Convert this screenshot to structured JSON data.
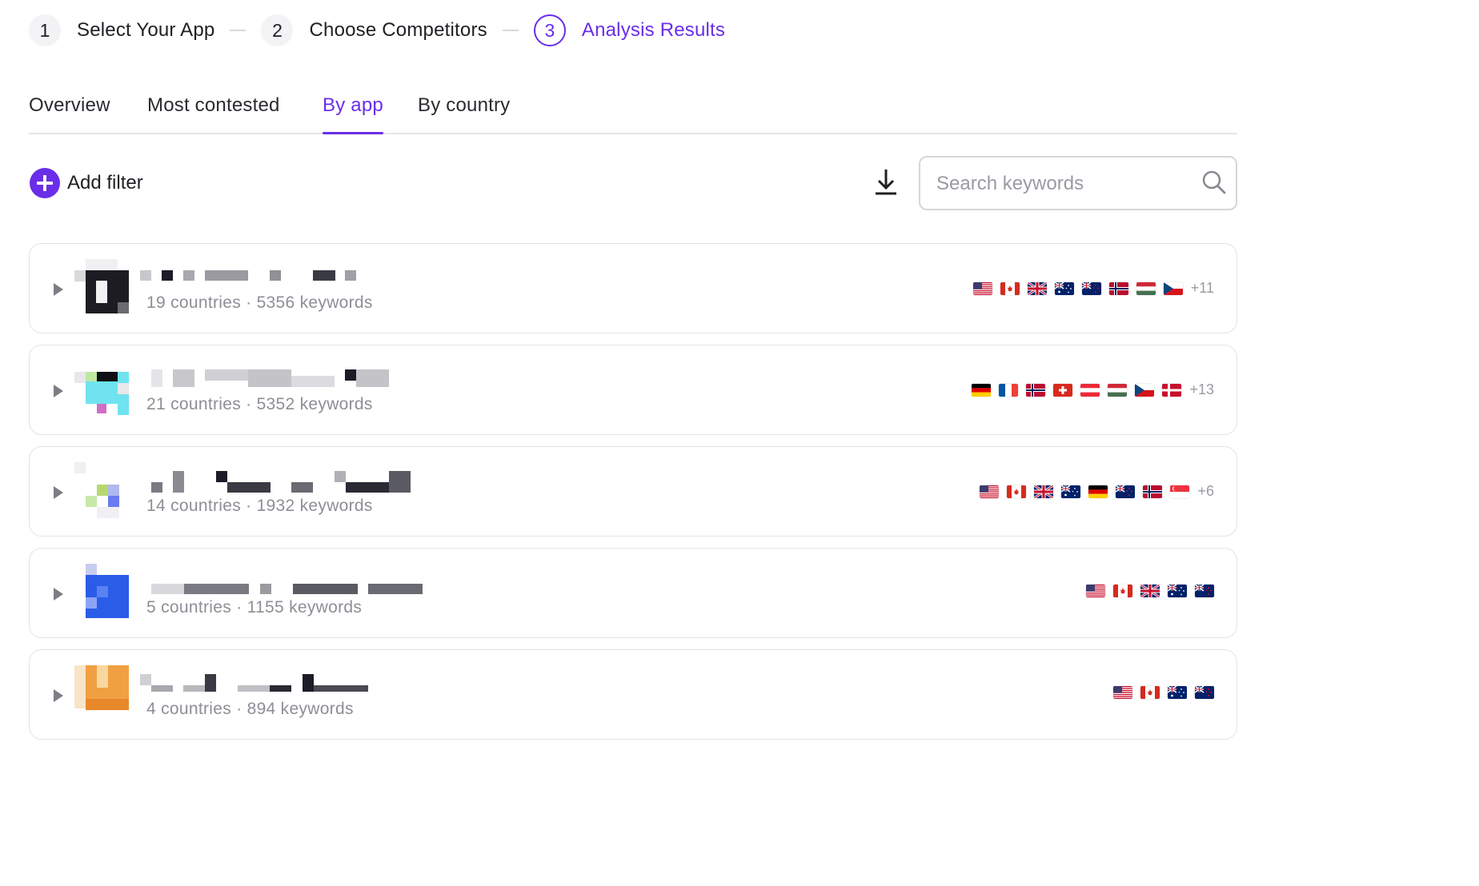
{
  "stepper": {
    "steps": [
      {
        "number": "1",
        "label": "Select Your App"
      },
      {
        "number": "2",
        "label": "Choose Competitors"
      },
      {
        "number": "3",
        "label": "Analysis Results"
      }
    ]
  },
  "tabs": [
    {
      "label": "Overview"
    },
    {
      "label": "Most contested"
    },
    {
      "label": "By app"
    },
    {
      "label": "By country"
    }
  ],
  "active_tab": "By app",
  "toolbar": {
    "add_filter_label": "Add filter",
    "download_icon": "download-icon",
    "search_placeholder": "Search keywords",
    "search_icon": "search-icon",
    "accent_color": "#6a2ee8"
  },
  "apps": [
    {
      "meta": "19 countries · 5356 keywords",
      "flags": [
        "us",
        "ca",
        "gb",
        "au",
        "nz",
        "no",
        "hu",
        "cz"
      ],
      "more": "+11"
    },
    {
      "meta": "21 countries · 5352 keywords",
      "flags": [
        "de",
        "fr",
        "no",
        "ch",
        "at",
        "hu",
        "cz",
        "dk"
      ],
      "more": "+13"
    },
    {
      "meta": "14 countries · 1932 keywords",
      "flags": [
        "us",
        "ca",
        "gb",
        "au",
        "de",
        "nz",
        "no",
        "sg"
      ],
      "more": "+6"
    },
    {
      "meta": "5 countries · 1155 keywords",
      "flags": [
        "us",
        "ca",
        "gb",
        "au",
        "nz"
      ],
      "more": ""
    },
    {
      "meta": "4 countries · 894 keywords",
      "flags": [
        "us",
        "ca",
        "au",
        "nz"
      ],
      "more": ""
    }
  ]
}
